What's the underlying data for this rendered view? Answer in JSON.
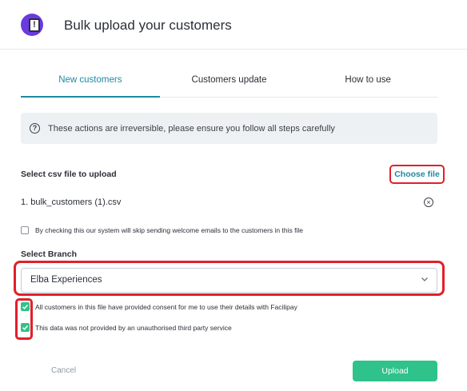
{
  "header": {
    "title": "Bulk upload your customers",
    "logo_icon": "document-alert-icon",
    "logo_mark": "!"
  },
  "tabs": [
    {
      "label": "New customers",
      "active": true
    },
    {
      "label": "Customers update",
      "active": false
    },
    {
      "label": "How to use",
      "active": false
    }
  ],
  "notice": {
    "icon": "question-circle-icon",
    "text": "These actions are irreversible, please ensure you follow all steps carefully"
  },
  "csv": {
    "label": "Select csv file to upload",
    "choose_label": "Choose file",
    "file_name": "1. bulk_customers (1).csv",
    "remove_icon": "close-circle-icon",
    "remove_glyph": "×"
  },
  "skip_email": {
    "label": "By checking this our system will skip sending welcome emails to the customers in this file",
    "checked": false
  },
  "branch": {
    "label": "Select Branch",
    "selected": "Elba Experiences"
  },
  "consents": [
    {
      "label": "All customers in this file have provided consent for me to use their details with Facilipay",
      "checked": true
    },
    {
      "label": "This data was not provided by an unauthorised third party service",
      "checked": true
    }
  ],
  "actions": {
    "cancel_label": "Cancel",
    "upload_label": "Upload"
  },
  "colors": {
    "accent": "#1e8aa0",
    "primary_button": "#2fc28a",
    "highlight": "#e0202a",
    "logo": "#6a3ae0"
  }
}
